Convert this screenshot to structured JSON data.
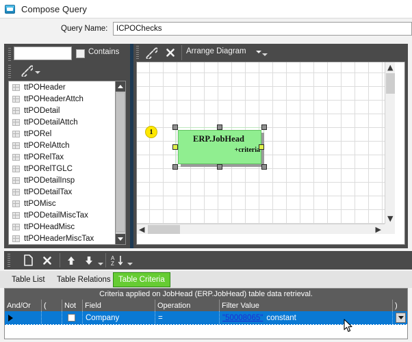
{
  "window": {
    "title": "Compose Query",
    "icon": "compose-query-icon"
  },
  "query_name": {
    "label": "Query Name:",
    "value": "ICPOChecks",
    "placeholder": ""
  },
  "left_panel": {
    "search": {
      "value": "",
      "placeholder": ""
    },
    "contains_label": "Contains",
    "contains_checked": false,
    "link_icon": "link-icon",
    "dropdown_icon": "chevron-down-icon",
    "tables": [
      "ttPOHeader",
      "ttPOHeaderAttch",
      "ttPODetail",
      "ttPODetailAttch",
      "ttPORel",
      "ttPORelAttch",
      "ttPORelTax",
      "ttPORelTGLC",
      "ttPODetailInsp",
      "ttPODetailTax",
      "ttPOMisc",
      "ttPODetailMiscTax",
      "ttPOHeadMisc",
      "ttPOHeaderMiscTax"
    ]
  },
  "diagram_panel": {
    "toolbar": {
      "link_icon": "link-icon",
      "close_icon": "close-icon",
      "arrange_label": "Arrange Diagram",
      "arrange_caret_icon": "chevron-down-icon",
      "overflow_caret_icon": "chevron-down-icon"
    },
    "node": {
      "badge": "1",
      "title": "ERP.JobHead",
      "criteria_label": "+criteria",
      "color": "#90ee90"
    },
    "scroll": {
      "up_icon": "chevron-up-icon",
      "down_icon": "chevron-down-icon",
      "left_icon": "chevron-left-icon",
      "right_icon": "chevron-right-icon"
    }
  },
  "bottom_panel": {
    "toolbar": {
      "new_icon": "new-document-icon",
      "delete_icon": "close-icon",
      "move_up_icon": "arrow-up-icon",
      "move_down_icon": "arrow-down-icon",
      "move_caret_icon": "chevron-down-icon",
      "sort_icon": "sort-az-icon",
      "sort_caret_icon": "chevron-down-icon"
    },
    "tabs": [
      {
        "label": "Table List",
        "active": false
      },
      {
        "label": "Table Relations",
        "active": false
      },
      {
        "label": "Table Criteria",
        "active": true
      }
    ],
    "grid": {
      "caption": "Criteria applied on JobHead (ERP.JobHead)  table data retrieval.",
      "columns": [
        "And/Or",
        "(",
        "Not",
        "Field",
        "Operation",
        "Filter Value",
        ")"
      ],
      "rows": [
        {
          "selected": true,
          "and_or": "",
          "open_paren": "",
          "not_checked": false,
          "field": "Company",
          "operation": "=",
          "filter_value_quoted": "\"50008065\"",
          "filter_value_kind": "constant",
          "close_paren": "",
          "dropdown_icon": "chevron-down-icon"
        }
      ]
    }
  },
  "colors": {
    "toolbar_dark": "#4a4a4a",
    "selection_blue": "#0a79d4",
    "tab_active_green": "#66cc33",
    "node_green": "#90ee90",
    "badge_yellow": "#ffe800",
    "link_blue": "#1c2fd4"
  }
}
